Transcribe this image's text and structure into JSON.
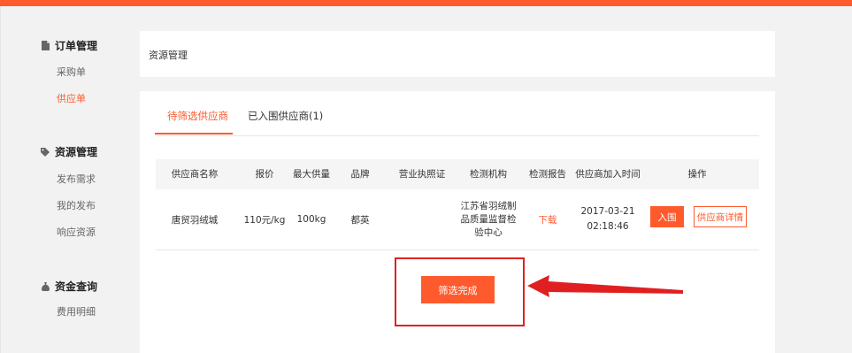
{
  "sidebar": {
    "groups": [
      {
        "title": "订单管理",
        "icon": "document-icon",
        "items": [
          {
            "label": "采购单"
          },
          {
            "label": "供应单"
          }
        ]
      },
      {
        "title": "资源管理",
        "icon": "tag-icon",
        "items": [
          {
            "label": "发布需求"
          },
          {
            "label": "我的发布"
          },
          {
            "label": "响应资源"
          }
        ]
      },
      {
        "title": "资金查询",
        "icon": "money-bag-icon",
        "items": [
          {
            "label": "费用明细"
          }
        ]
      }
    ]
  },
  "header": {
    "title": "资源管理"
  },
  "tabs": [
    {
      "label": "待筛选供应商"
    },
    {
      "label": "已入围供应商(1)"
    }
  ],
  "table": {
    "columns": [
      "供应商名称",
      "报价",
      "最大供量",
      "品牌",
      "营业执照证",
      "检测机构",
      "检测报告",
      "供应商加入时间",
      "操作"
    ],
    "rows": [
      {
        "name": "唐贸羽绒城",
        "price": "110元/kg",
        "max_supply": "100kg",
        "brand": "都英",
        "license": "",
        "institution": "江苏省羽绒制品质量监督检验中心",
        "report": "下载",
        "join_time": "2017-03-21 02:18:46",
        "action_join": "入围",
        "action_detail": "供应商详情"
      }
    ]
  },
  "finish_button": "筛选完成",
  "colors": {
    "accent": "#ff5a2d",
    "annotation": "#e02020"
  }
}
